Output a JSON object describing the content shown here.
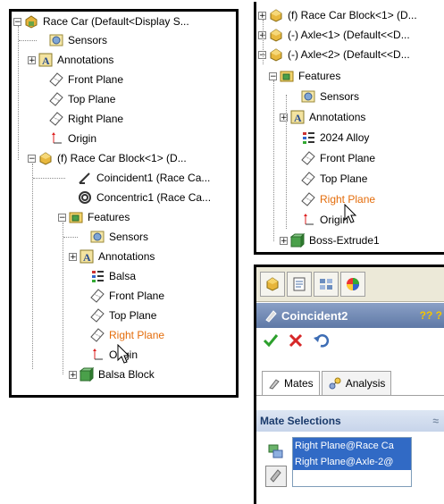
{
  "left_tree": {
    "items": [
      {
        "label": "Race Car  (Default<Display S...",
        "icon": "assembly-icon",
        "expander": "−"
      },
      {
        "label": "Sensors",
        "icon": "sensors-icon"
      },
      {
        "label": "Annotations",
        "icon": "annotations-icon",
        "expander": "+"
      },
      {
        "label": "Front Plane",
        "icon": "plane-icon"
      },
      {
        "label": "Top Plane",
        "icon": "plane-icon"
      },
      {
        "label": "Right Plane",
        "icon": "plane-icon"
      },
      {
        "label": "Origin",
        "icon": "origin-icon"
      },
      {
        "label": "(f) Race Car Block<1> (D...",
        "icon": "part-icon",
        "expander": "−"
      },
      {
        "label": "Coincident1 (Race Ca...",
        "icon": "coincident-mate-icon"
      },
      {
        "label": "Concentric1 (Race Ca...",
        "icon": "concentric-mate-icon"
      },
      {
        "label": "Features",
        "icon": "features-folder-icon",
        "expander": "−"
      },
      {
        "label": "Sensors",
        "icon": "sensors-icon"
      },
      {
        "label": "Annotations",
        "icon": "annotations-icon",
        "expander": "+"
      },
      {
        "label": "Balsa",
        "icon": "material-icon"
      },
      {
        "label": "Front Plane",
        "icon": "plane-icon"
      },
      {
        "label": "Top Plane",
        "icon": "plane-icon"
      },
      {
        "label": "Right Plane",
        "icon": "plane-icon",
        "highlight": true
      },
      {
        "label": "Origin",
        "icon": "origin-icon"
      },
      {
        "label": "Balsa Block",
        "icon": "extrude-icon",
        "expander": "+"
      }
    ]
  },
  "right_tree": {
    "items": [
      {
        "label": "(f) Race Car Block<1> (D...",
        "icon": "part-icon",
        "expander": "+"
      },
      {
        "label": "(-) Axle<1> (Default<<D...",
        "icon": "part-icon",
        "expander": "+"
      },
      {
        "label": "(-) Axle<2> (Default<<D...",
        "icon": "part-icon",
        "expander": "−"
      },
      {
        "label": "Features",
        "icon": "features-folder-icon",
        "expander": "−"
      },
      {
        "label": "Sensors",
        "icon": "sensors-icon"
      },
      {
        "label": "Annotations",
        "icon": "annotations-icon",
        "expander": "+"
      },
      {
        "label": "2024 Alloy",
        "icon": "material-icon"
      },
      {
        "label": "Front Plane",
        "icon": "plane-icon"
      },
      {
        "label": "Top Plane",
        "icon": "plane-icon"
      },
      {
        "label": "Right Plane",
        "icon": "plane-icon",
        "highlight": true
      },
      {
        "label": "Origin",
        "icon": "origin-icon"
      },
      {
        "label": "Boss-Extrude1",
        "icon": "extrude-icon",
        "expander": "+"
      }
    ]
  },
  "property_manager": {
    "title": "Coincident2",
    "help_icons": "?? ?",
    "tabs": [
      "Mates",
      "Analysis"
    ],
    "section_title": "Mate Selections",
    "selections": [
      "Right Plane@Race Ca",
      "Right Plane@Axle-2@"
    ]
  },
  "colors": {
    "highlight_text": "#e46c0a",
    "selection_bg": "#316ac5",
    "title_bar": "#6b84b0"
  }
}
